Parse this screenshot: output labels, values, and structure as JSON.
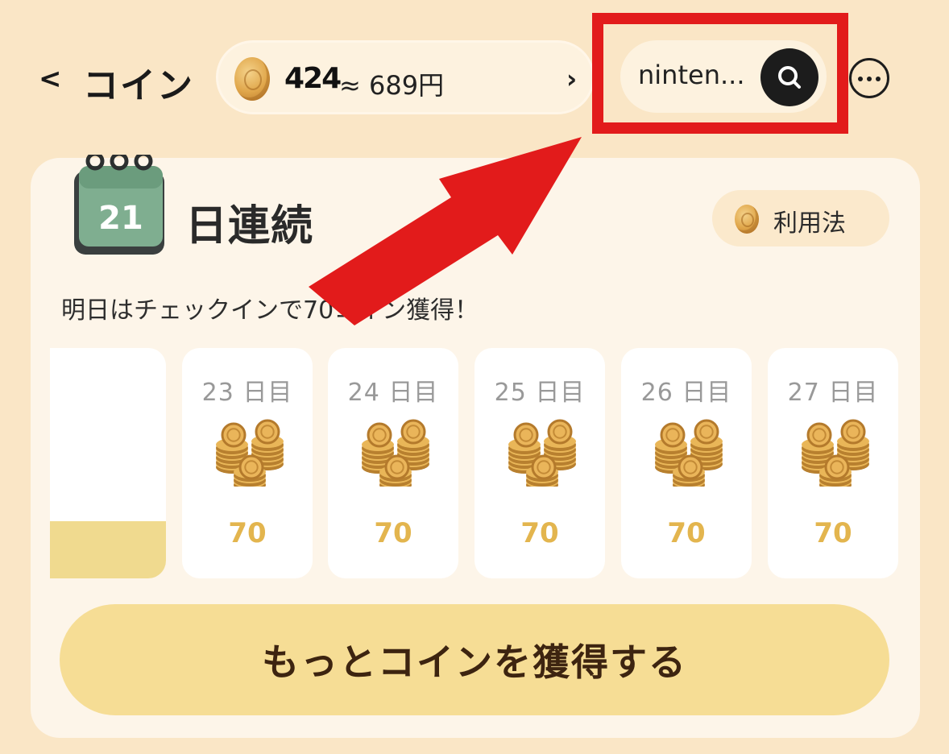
{
  "header": {
    "back_label": "<",
    "title": "コイン",
    "balance_number": "424",
    "balance_yen": "≈ 689円",
    "balance_chevron": "›",
    "search_text": "ninten..."
  },
  "streak": {
    "calendar_day": "21",
    "label": "日連続",
    "howto_label": "利用法",
    "subtitle": "明日はチェックインで70コイン獲得！"
  },
  "days": [
    {
      "label": "23 日目",
      "amount": "70"
    },
    {
      "label": "24 日目",
      "amount": "70"
    },
    {
      "label": "25 日目",
      "amount": "70"
    },
    {
      "label": "26 日目",
      "amount": "70"
    },
    {
      "label": "27 日目",
      "amount": "70"
    }
  ],
  "previous_day_progress": 0.25,
  "cta_label": "もっとコインを獲得する",
  "colors": {
    "background": "#fae6c6",
    "highlight": "#e21b1b",
    "cta": "#f6dd95",
    "amount": "#e3b54e"
  }
}
